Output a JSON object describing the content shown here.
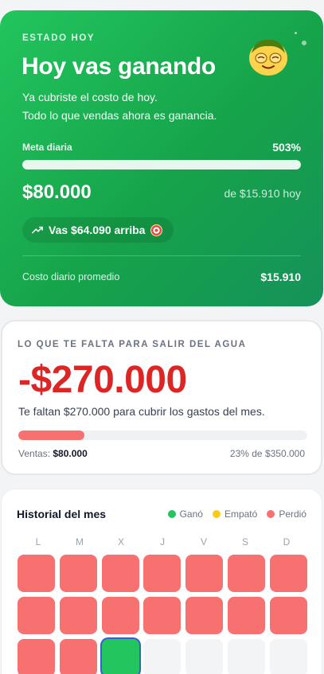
{
  "today": {
    "kicker": "ESTADO HOY",
    "title": "Hoy vas ganando",
    "subtitle_line1": "Ya cubriste el costo de hoy.",
    "subtitle_line2": "Todo lo que vendas ahora es ganancia.",
    "goal_label": "Meta diaria",
    "goal_percent_text": "503%",
    "goal_progress_fraction": 1.0,
    "sales_value": "$80.000",
    "of_cost": "de $15.910 hoy",
    "ahead_text": "Vas $64.090 arriba",
    "avg_cost_label": "Costo diario promedio",
    "avg_cost_value": "$15.910",
    "mascot_icon": "smiling-mascot-icon"
  },
  "deficit": {
    "kicker": "LO QUE TE FALTA PARA SALIR DEL AGUA",
    "amount": "-$270.000",
    "description": "Te faltan $270.000 para cubrir los gastos del mes.",
    "sales_label": "Ventas:",
    "sales_value": "$80.000",
    "percent_text": "23% de $350.000",
    "progress_fraction": 0.23
  },
  "history": {
    "title": "Historial del mes",
    "legend": [
      {
        "label": "Ganó",
        "color": "#22c55e"
      },
      {
        "label": "Empató",
        "color": "#facc15"
      },
      {
        "label": "Perdió",
        "color": "#f87171"
      }
    ],
    "weekdays": [
      "L",
      "M",
      "X",
      "J",
      "V",
      "S",
      "D"
    ],
    "days": [
      "lost",
      "lost",
      "lost",
      "lost",
      "lost",
      "lost",
      "lost",
      "lost",
      "lost",
      "lost",
      "lost",
      "lost",
      "lost",
      "lost",
      "lost",
      "lost",
      "won",
      "empty",
      "empty",
      "empty",
      "empty"
    ]
  },
  "colors": {
    "brand_green": "#22c55e",
    "danger_red": "#dc2626",
    "lost_red": "#f87171"
  }
}
